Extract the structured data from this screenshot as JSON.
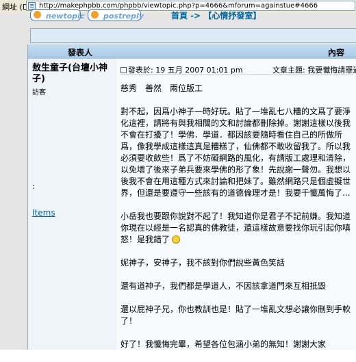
{
  "browser": {
    "address_label": "網址 (D)",
    "url": "http://makephpbb.com/phpbb/viewtopic.php?p=4666&mforum=againstue#4666"
  },
  "buttons": {
    "new_topic": "newtopic",
    "post_reply": "postreply"
  },
  "breadcrumb": "首頁 -> 【心情抒發室】",
  "table": {
    "col_author": "發表人",
    "col_message": "內容"
  },
  "post": {
    "author": "敖生童子(台壇小神子)",
    "rank": "訪客",
    "colon": ":",
    "items_link": "Items",
    "posted_label": "發表於: 19 五月 2007 01:01 pm",
    "subject": "文章主題: 我要懺悔請罪過",
    "paragraphs": [
      "慈秀　善然　兩位版工",
      "對不起，因爲小神子一時好玩。貼了一堆亂七八糟的文爲了要淨化這裡，請將有與我相關的文和討論都刪除掉。謝謝這樣以後我不會在打擾了！學佛．學道．都因該要隨時看住自己的所做所爲，像我學成這樣這真是糟糕了，仙佛都不敢收留我了。所以我必須要收斂些！爲了不妨礙網路的風化，有請版工處理和清除，以免壞了後來子弟兵要來學佛的形了象！先說謝一聲勿。我想以後我不會在用這種方式來討論和把妹了。雖然網路只是個虛擬世界，但還是要遵守一些該有的道德倫理才是！我要千懺萬悔了...",
      "小岳我也要跟你說對不起了！我知道你是君子不記前嫌。我知道你現在以經是一名認真的佛教徒，還這樣故意要找你玩引起你嗔怒！是我錯了",
      "妮神子，安神子，我不該對你們說些黃色笑話",
      "還有道神子，我們都是學道人，不因該拿道門來互相抵毀",
      "還以屁神子兄，你也教訓也是！貼了一堆亂文想必讓你刪到手軟了！",
      "好了！我懺悔完畢，希望各位包涵小弟的無知！謝謝大家"
    ]
  }
}
